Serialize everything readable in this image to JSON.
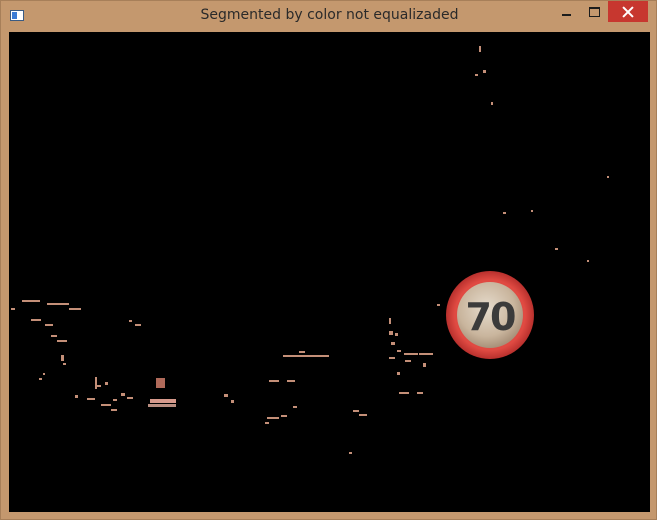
{
  "window": {
    "title": "Segmented by color not equalizaded"
  },
  "controls": {
    "icon": "app-window-icon",
    "minimize": "minimize-icon",
    "maximize": "maximize-icon",
    "close": "close-icon"
  },
  "image": {
    "sign_number": "70",
    "colors": {
      "frame": "#c4986e",
      "background": "#000000",
      "sign_ring": "#d13c3a",
      "sign_face": "#c8b49c",
      "speck": "#c48f78"
    }
  }
}
